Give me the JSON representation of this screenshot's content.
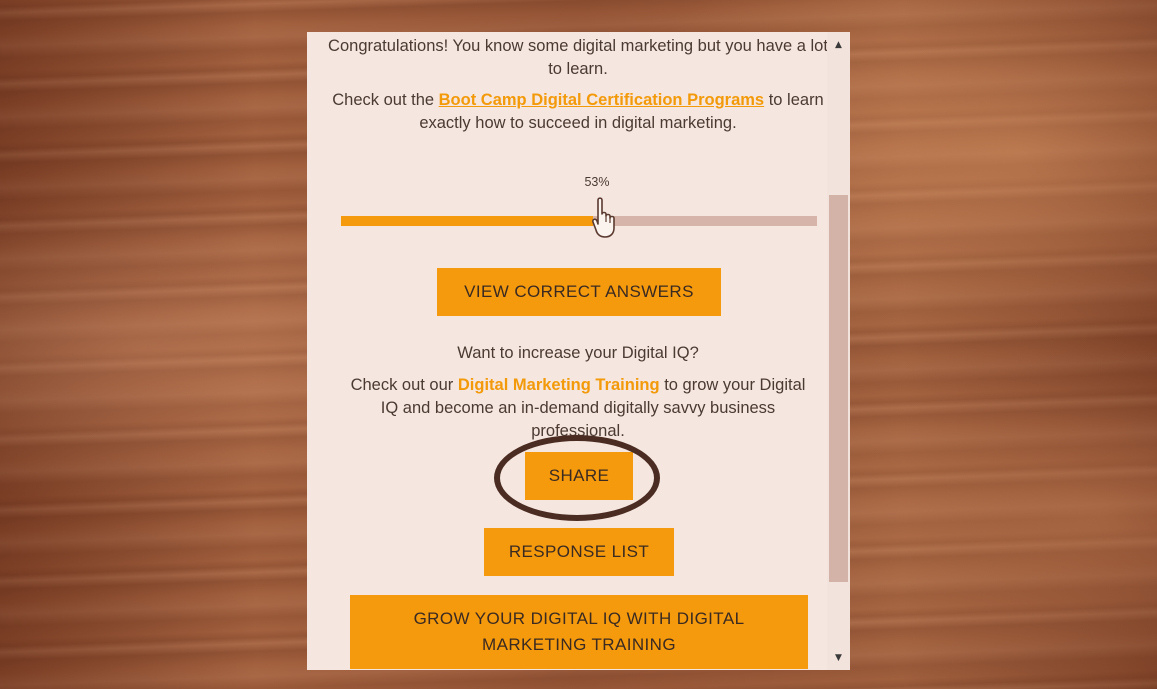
{
  "result": {
    "congrats_text": "Congratulations! You know some digital marketing but you have a lot to learn.",
    "check_out_prefix": "Check out the",
    "certification_link": "Boot Camp Digital Certification Programs",
    "check_out_suffix": "to learn exactly how to succeed in digital marketing."
  },
  "score": {
    "label": "53%",
    "fraction": 0.53
  },
  "buttons": {
    "view_answers": "VIEW CORRECT ANSWERS",
    "share": "SHARE",
    "response_list": "RESPONSE LIST",
    "grow_iq": "GROW YOUR DIGITAL IQ WITH DIGITAL MARKETING TRAINING"
  },
  "promo": {
    "question": "Want to increase your Digital IQ?",
    "prefix": "Check out our",
    "training_link": "Digital Marketing Training",
    "suffix": "to grow your Digital IQ and become an in-demand digitally savvy business professional."
  },
  "icons": {
    "cursor": "pointer-hand-icon",
    "scroll_up": "scroll-up-arrow-icon",
    "scroll_down": "scroll-down-arrow-icon"
  },
  "colors": {
    "accent": "#f59a0c",
    "link": "#f39a0a",
    "panel_bg": "#f5e6df",
    "text": "#4a3a32",
    "track": "#d7b4a9",
    "highlight_ring": "#4a2c22"
  }
}
